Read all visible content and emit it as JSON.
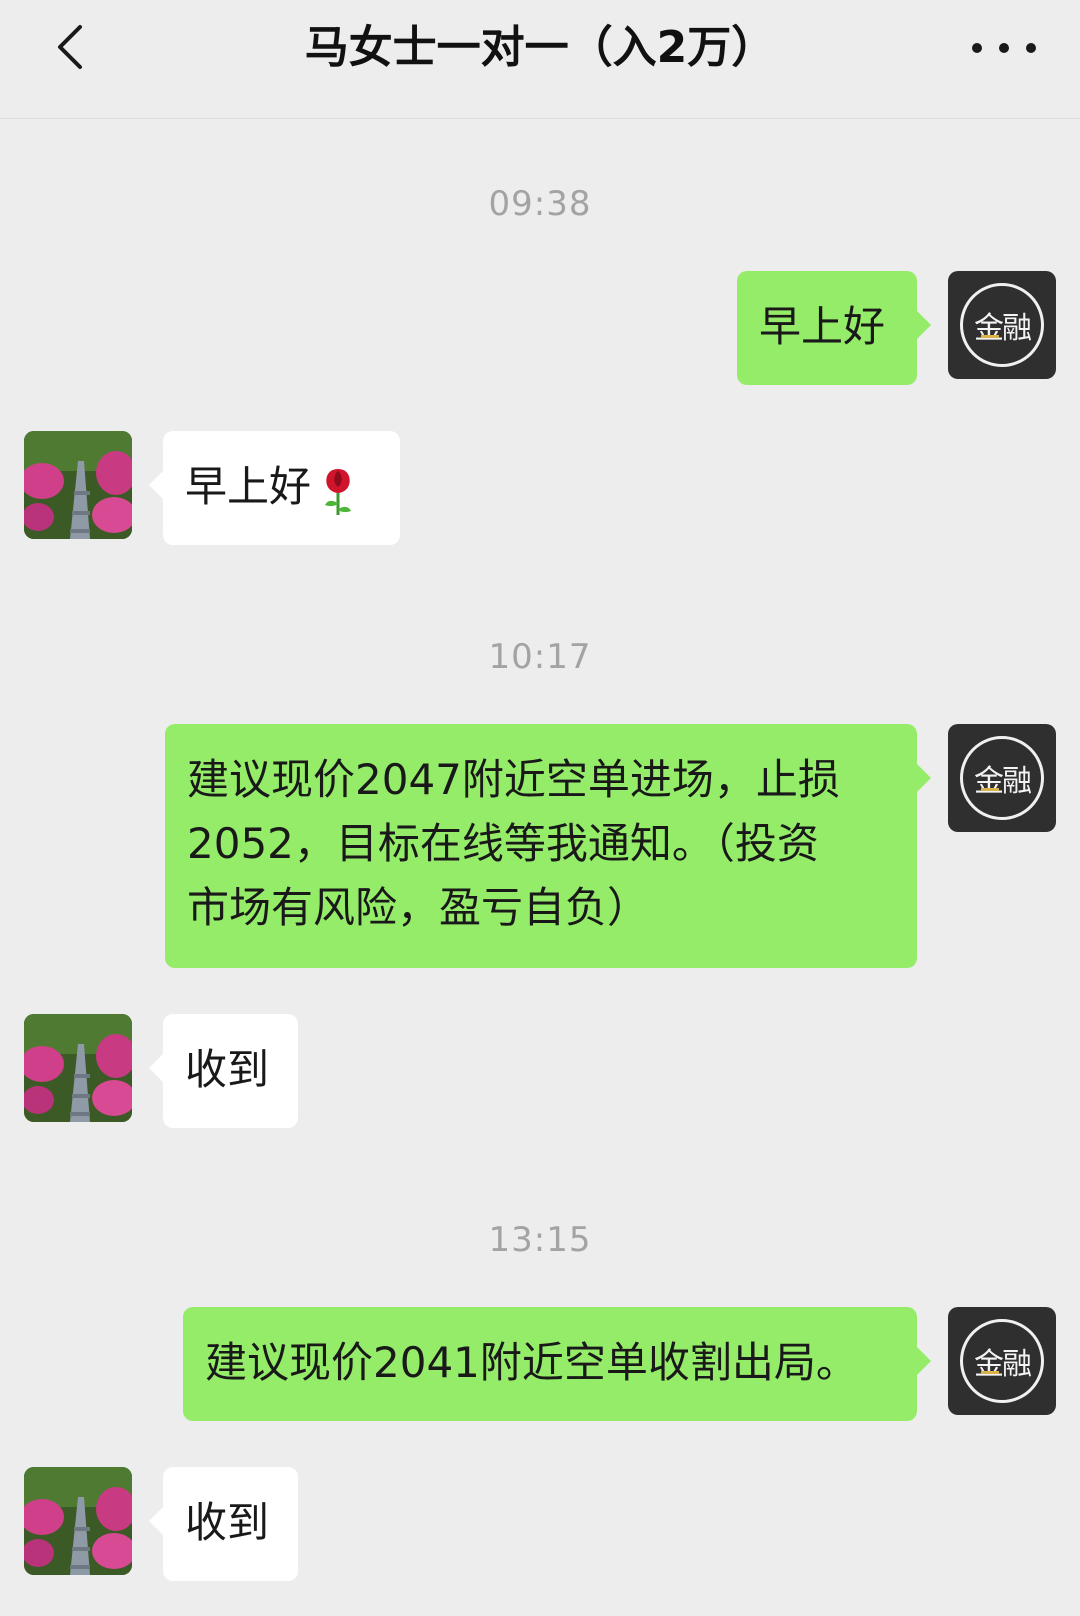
{
  "header": {
    "title": "马女士一对一（入2万）",
    "back_icon": "chevron-left-icon",
    "more_icon": "more-dots-icon"
  },
  "self_avatar_label": "金融",
  "messages": [
    {
      "type": "time",
      "text": "09:38"
    },
    {
      "type": "msg",
      "sender": "me",
      "text": "早上好"
    },
    {
      "type": "msg",
      "sender": "peer",
      "text": "早上好",
      "emoji": "rose-emoji"
    },
    {
      "type": "time",
      "text": "10:17"
    },
    {
      "type": "msg",
      "sender": "me",
      "lines": [
        "建议现价2047附近空单进场，止损",
        "2052，目标在线等我通知。（投资",
        "市场有风险，盈亏自负）"
      ]
    },
    {
      "type": "msg",
      "sender": "peer",
      "text": "收到"
    },
    {
      "type": "time",
      "text": "13:15"
    },
    {
      "type": "msg",
      "sender": "me",
      "text": "建议现价2041附近空单收割出局。"
    },
    {
      "type": "msg",
      "sender": "peer",
      "text": "收到"
    }
  ],
  "colors": {
    "background": "#ededed",
    "my_bubble": "#95ec69",
    "peer_bubble": "#ffffff",
    "timestamp": "#a3a3a3"
  }
}
